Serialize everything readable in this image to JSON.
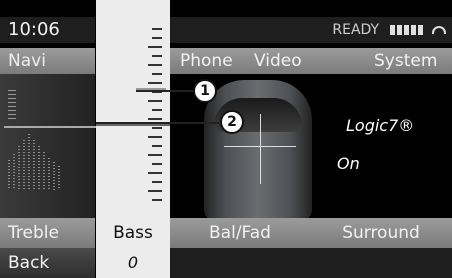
{
  "status": {
    "time": "10:06",
    "ready": "READY"
  },
  "nav": {
    "navi": "Navi"
  },
  "top_menu": {
    "phone": "Phone",
    "video": "Video",
    "system": "System"
  },
  "sound": {
    "mode": "Logic7®",
    "state": "On"
  },
  "callouts": {
    "one": "1",
    "two": "2"
  },
  "bottom_menu": {
    "treble": "Treble",
    "bass": "Bass",
    "balfad": "Bal/Fad",
    "surround": "Surround"
  },
  "bottom_row": {
    "back": "Back",
    "bass_value": "0"
  },
  "icons": {
    "signal": "signal-strength-icon",
    "phone": "phone-handset-icon",
    "car": "car-top-view-icon"
  },
  "colors": {
    "background": "#000000",
    "selection": "#ececec",
    "menu_gray": "#8b8b8b"
  }
}
